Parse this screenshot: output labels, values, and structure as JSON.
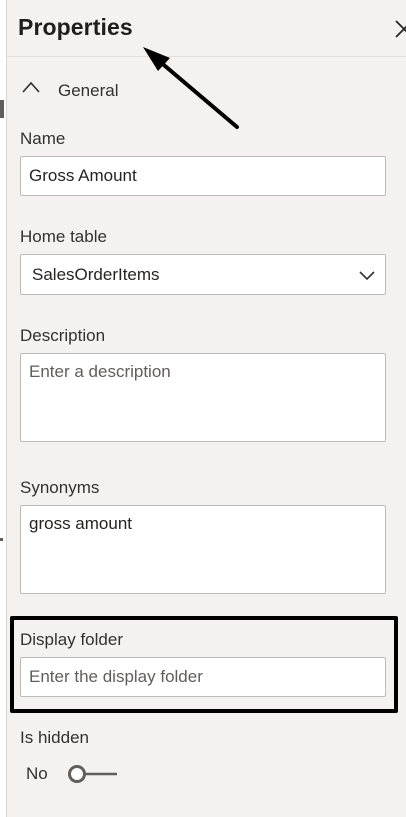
{
  "panel": {
    "title": "Properties",
    "close_icon": "close-icon"
  },
  "general_section": {
    "label": "General",
    "icon": "chevron-up-icon",
    "expanded": true
  },
  "name_field": {
    "label": "Name",
    "value": "Gross Amount"
  },
  "home_table": {
    "label": "Home table",
    "selected": "SalesOrderItems",
    "icon": "chevron-down-icon"
  },
  "description": {
    "label": "Description",
    "placeholder": "Enter a description",
    "value": ""
  },
  "synonyms": {
    "label": "Synonyms",
    "value": "gross amount"
  },
  "display_folder": {
    "label": "Display folder",
    "placeholder": "Enter the display folder",
    "value": ""
  },
  "is_hidden": {
    "label": "Is hidden",
    "state_label": "No",
    "on": false
  },
  "colors": {
    "panel_bg": "#f3f2f1",
    "field_border": "#bdbbb8",
    "text": "#252423",
    "annotation": "#000000"
  }
}
